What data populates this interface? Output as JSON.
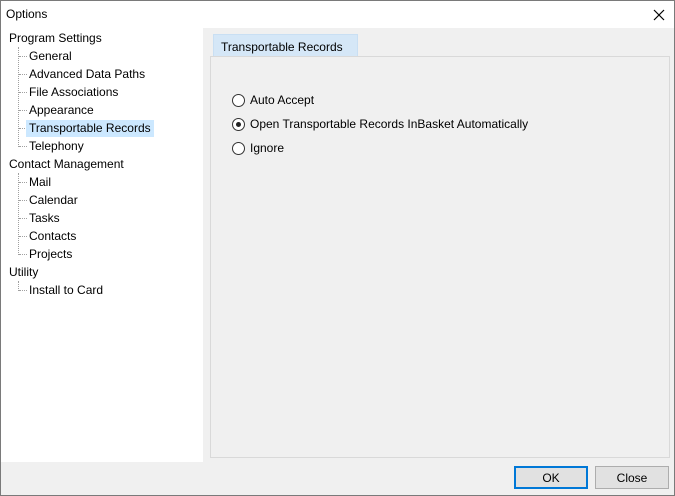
{
  "window": {
    "title": "Options",
    "close_icon": "close-icon"
  },
  "tree": {
    "groups": [
      {
        "label": "Program Settings",
        "children": [
          "General",
          "Advanced Data Paths",
          "File Associations",
          "Appearance",
          "Transportable Records",
          "Telephony"
        ]
      },
      {
        "label": "Contact Management",
        "children": [
          "Mail",
          "Calendar",
          "Tasks",
          "Contacts",
          "Projects"
        ]
      },
      {
        "label": "Utility",
        "children": [
          "Install to Card"
        ]
      }
    ],
    "selected": "Transportable Records"
  },
  "tab": {
    "label": "Transportable Records"
  },
  "options": {
    "auto_accept": "Auto Accept",
    "open_inbasket": "Open Transportable Records InBasket Automatically",
    "ignore": "Ignore",
    "selected": "open_inbasket"
  },
  "buttons": {
    "ok": "OK",
    "close": "Close"
  },
  "colors": {
    "selection": "#cce8ff",
    "tab": "#d5e7f7",
    "ok_border": "#0078d7"
  }
}
